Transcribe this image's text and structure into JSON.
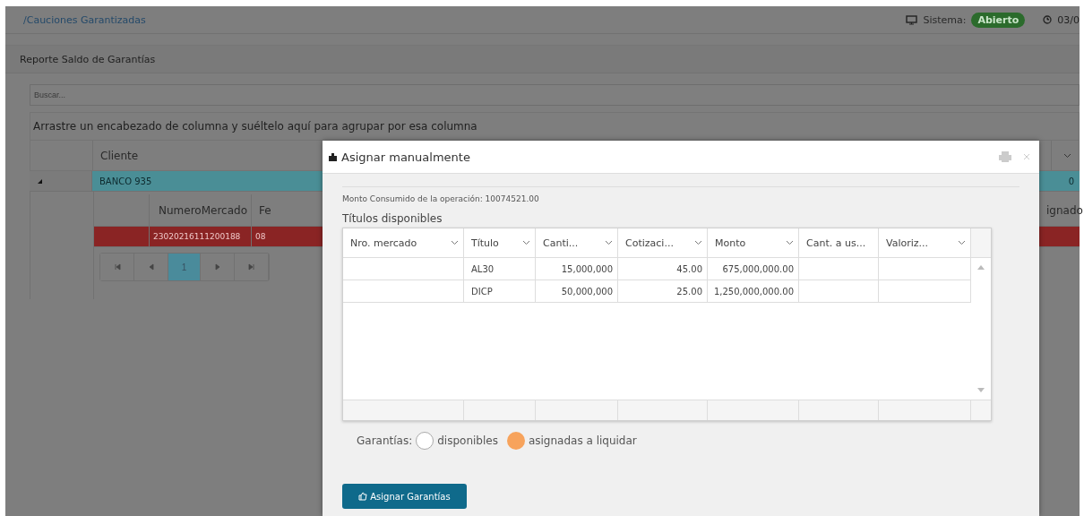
{
  "breadcrumb": "/Cauciones Garantizadas",
  "system": {
    "label": "Sistema:",
    "status": "Abierto",
    "clock": "03/0"
  },
  "panel": {
    "title": "Reporte Saldo de Garantías"
  },
  "search": {
    "placeholder": "Buscar..."
  },
  "group_panel": "Arrastre un encabezado de columna y suéltelo aquí para agrupar por esa columna",
  "grid": {
    "columns": [
      "Cliente"
    ],
    "group_row": {
      "expanded": true,
      "label": "BANCO 935",
      "value": "0"
    },
    "detail": {
      "columns": [
        "NumeroMercado",
        "Fe",
        "ignado"
      ],
      "rows": [
        {
          "cells": [
            "23020216111200188",
            "08"
          ]
        }
      ]
    },
    "pager": [
      {
        "label": "1",
        "selected": true
      }
    ]
  },
  "dialog": {
    "title": "Asignar manualmente",
    "consumed": "Monto Consumido de la operación: 10074521.00",
    "subtitle": "Títulos disponibles",
    "columns": [
      {
        "label": "Nro. mercado"
      },
      {
        "label": "Título"
      },
      {
        "label": "Canti..."
      },
      {
        "label": "Cotizaci..."
      },
      {
        "label": "Monto"
      },
      {
        "label": "Cant. a us..."
      },
      {
        "label": "Valoriz..."
      }
    ],
    "rows": [
      {
        "cells": [
          "",
          "AL30",
          "15,000,000",
          "45.00",
          "675,000,000.00",
          "",
          ""
        ]
      },
      {
        "cells": [
          "",
          "DICP",
          "50,000,000",
          "25.00",
          "1,250,000,000.00",
          "",
          ""
        ]
      }
    ],
    "legend": {
      "label": "Garantías:",
      "items": [
        {
          "label": "disponibles",
          "color": "#ffffff"
        },
        {
          "label": "asignadas a liquidar",
          "color": "#f7a35c"
        }
      ]
    },
    "button": "Asignar Garantías"
  }
}
